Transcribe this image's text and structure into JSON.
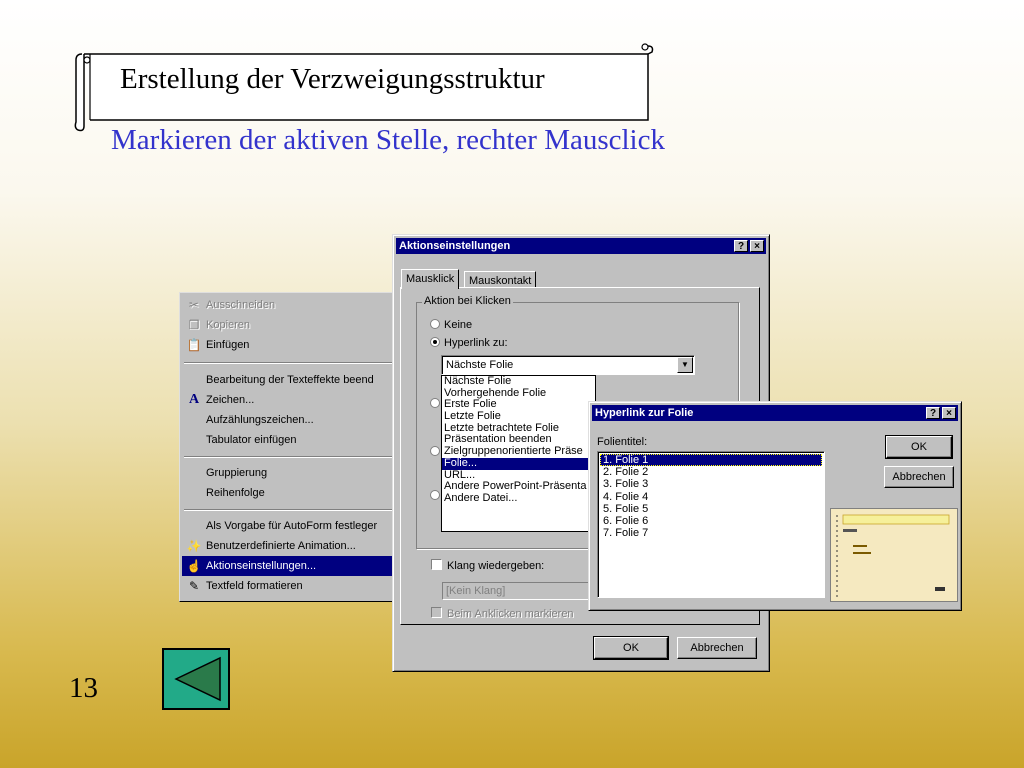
{
  "slide": {
    "title": "Erstellung der Verzweigungsstruktur",
    "subtitle": "Markieren der aktiven Stelle, rechter Mausclick",
    "number": "13",
    "back_icon": "triangle-left-icon",
    "colors": {
      "subtitle": "#3333cc",
      "back_button": "#22aa88",
      "titlebar": "#000080"
    }
  },
  "context_menu": {
    "items": [
      {
        "label": "Ausschneiden",
        "icon": "scissors-icon",
        "disabled": true
      },
      {
        "label": "Kopieren",
        "icon": "copy-icon",
        "disabled": true
      },
      {
        "label": "Einfügen",
        "icon": "paste-icon",
        "disabled": false
      },
      {
        "label": "Bearbeitung der Texteffekte beend",
        "disabled": false
      },
      {
        "label": "Zeichen...",
        "icon": "font-a-icon",
        "disabled": false
      },
      {
        "label": "Aufzählungszeichen...",
        "disabled": false
      },
      {
        "label": "Tabulator einfügen",
        "disabled": false
      },
      {
        "label": "Gruppierung",
        "disabled": false
      },
      {
        "label": "Reihenfolge",
        "disabled": false
      },
      {
        "label": "Als Vorgabe für AutoForm festleger",
        "disabled": false
      },
      {
        "label": "Benutzerdefinierte Animation...",
        "icon": "animation-icon",
        "disabled": false
      },
      {
        "label": "Aktionseinstellungen...",
        "icon": "action-icon",
        "selected": true
      },
      {
        "label": "Textfeld formatieren",
        "icon": "format-icon",
        "disabled": false
      }
    ]
  },
  "action_dialog": {
    "title": "Aktionseinstellungen",
    "help": "?",
    "close": "×",
    "tabs": [
      "Mausklick",
      "Mauskontakt"
    ],
    "group_label": "Aktion bei Klicken",
    "radio_none": "Keine",
    "radio_hyperlink": "Hyperlink zu:",
    "combo_value": "Nächste Folie",
    "dropdown_items": [
      "Nächste Folie",
      "Vorhergehende Folie",
      "Erste Folie",
      "Letzte Folie",
      "Letzte betrachtete Folie",
      "Präsentation beenden",
      "Zielgruppenorientierte Präse",
      "Folie...",
      "URL...",
      "Andere PowerPoint-Präsenta",
      "Andere Datei..."
    ],
    "dropdown_selected": 7,
    "sound_label": "Klang wiedergeben:",
    "sound_value": "[Kein Klang]",
    "highlight_label": "Beim Anklicken markieren",
    "ok": "OK",
    "cancel": "Abbrechen"
  },
  "hyperlink_dialog": {
    "title": "Hyperlink zur Folie",
    "help": "?",
    "close": "×",
    "list_label": "Folientitel:",
    "slides": [
      "1. Folie 1",
      "2. Folie 2",
      "3. Folie 3",
      "4. Folie 4",
      "5. Folie 5",
      "6. Folie 6",
      "7. Folie 7"
    ],
    "selected_index": 0,
    "ok": "OK",
    "cancel": "Abbrechen"
  }
}
